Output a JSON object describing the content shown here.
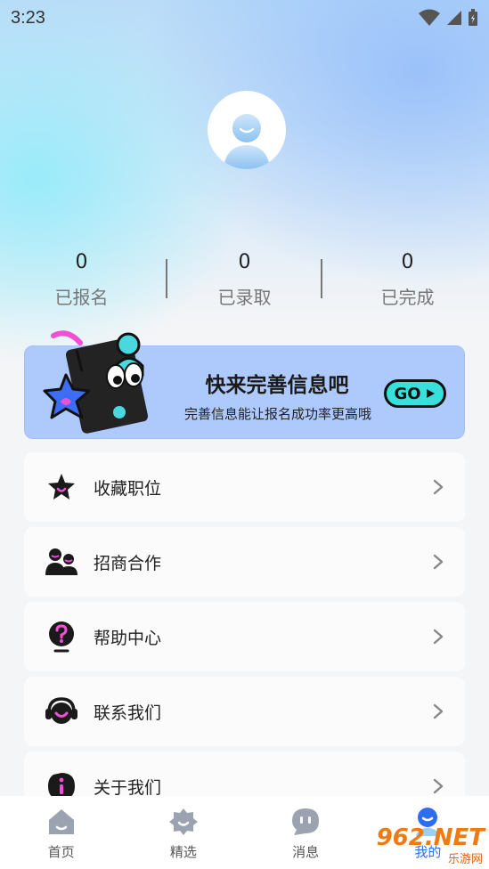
{
  "status_bar": {
    "time": "3:23"
  },
  "profile": {
    "avatar_icon": "user-avatar-icon"
  },
  "stats": [
    {
      "value": "0",
      "label": "已报名"
    },
    {
      "value": "0",
      "label": "已录取"
    },
    {
      "value": "0",
      "label": "已完成"
    }
  ],
  "banner": {
    "title": "快来完善信息吧",
    "subtitle": "完善信息能让报名成功率更高哦",
    "go_label": "GO"
  },
  "menu": [
    {
      "label": "收藏职位",
      "icon": "star-icon"
    },
    {
      "label": "招商合作",
      "icon": "partners-icon"
    },
    {
      "label": "帮助中心",
      "icon": "help-icon"
    },
    {
      "label": "联系我们",
      "icon": "headset-icon"
    },
    {
      "label": "关于我们",
      "icon": "info-icon"
    }
  ],
  "tabbar": [
    {
      "label": "首页",
      "icon": "home-icon"
    },
    {
      "label": "精选",
      "icon": "featured-icon"
    },
    {
      "label": "消息",
      "icon": "message-icon"
    },
    {
      "label": "我的",
      "icon": "profile-icon",
      "active": true
    }
  ],
  "watermark": {
    "brand": "962.NET",
    "sub": "乐游网"
  },
  "colors": {
    "accent": "#2f6df0",
    "banner_bg": "#aec9fb",
    "go_bg": "#38e0dc",
    "icon_pink": "#f04fd6"
  }
}
